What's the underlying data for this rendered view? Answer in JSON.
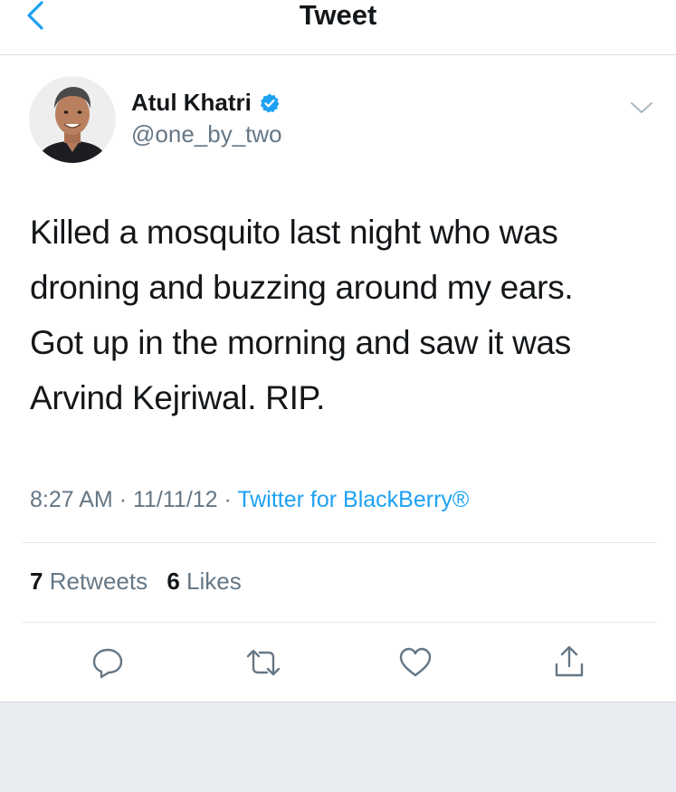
{
  "nav": {
    "title": "Tweet"
  },
  "tweet": {
    "author": {
      "name": "Atul Khatri",
      "handle": "@one_by_two",
      "verified": true
    },
    "text_lines": [
      "Killed a mosquito last night who was",
      "droning and buzzing around my ears.",
      "Got up in the morning and saw it was",
      "Arvind Kejriwal. RIP."
    ],
    "time": "8:27 AM",
    "date": "11/11/12",
    "separator": "·",
    "source": "Twitter for BlackBerry®",
    "stats": {
      "retweets_count": "7",
      "retweets_label": "Retweets",
      "likes_count": "6",
      "likes_label": "Likes"
    }
  },
  "colors": {
    "accent": "#1da1f2",
    "text_primary": "#14171a",
    "text_secondary": "#657786",
    "divider": "#e1e8ed",
    "bottom_bar": "#e6ecf0"
  },
  "icons": {
    "back": "chevron-left-icon",
    "verified": "verified-badge-icon",
    "more": "chevron-down-icon",
    "reply": "reply-icon",
    "retweet": "retweet-icon",
    "like": "heart-icon",
    "share": "share-icon"
  }
}
